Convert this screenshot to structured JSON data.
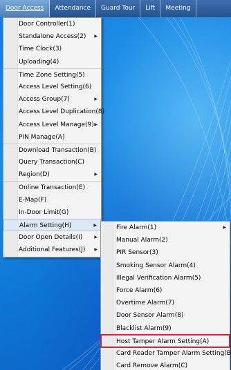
{
  "menubar": {
    "items": [
      {
        "label": "Door Access",
        "active": true
      },
      {
        "label": "Attendance"
      },
      {
        "label": "Guard Tour"
      },
      {
        "label": "Lift"
      },
      {
        "label": "Meeting"
      }
    ]
  },
  "door_access_menu": {
    "items": [
      {
        "label": "Door Controller(1)"
      },
      {
        "label": "Standalone Access(2)",
        "submenu": true
      },
      {
        "label": "Time Clock(3)"
      },
      {
        "label": "Uploading(4)"
      },
      {
        "label": "Time Zone Setting(5)"
      },
      {
        "label": "Access Level Setting(6)"
      },
      {
        "label": "Access Group(7)",
        "submenu": true
      },
      {
        "label": "Access Level Duplication(8)"
      },
      {
        "label": "Access Level Manage(9)",
        "submenu": true
      },
      {
        "label": "PIN Manage(A)"
      },
      {
        "label": "Download Transaction(B)"
      },
      {
        "label": "Query Transaction(C)"
      },
      {
        "label": "Region(D)",
        "submenu": true
      },
      {
        "label": "Online Transaction(E)"
      },
      {
        "label": "E-Map(F)"
      },
      {
        "label": "In-Door Limit(G)"
      },
      {
        "label": "Alarm Setting(H)",
        "submenu": true,
        "highlighted": true
      },
      {
        "label": "Door Open Details(I)",
        "submenu": true
      },
      {
        "label": "Additional Features(J)",
        "submenu": true
      }
    ]
  },
  "alarm_setting_menu": {
    "items": [
      {
        "label": "Fire Alarm(1)",
        "submenu": true
      },
      {
        "label": "Manual Alarm(2)"
      },
      {
        "label": "PIR Sensor(3)"
      },
      {
        "label": "Smoking Sensor Alarm(4)"
      },
      {
        "label": "Illegal Verification Alarm(5)"
      },
      {
        "label": "Force Alarm(6)"
      },
      {
        "label": "Overtime Alarm(7)"
      },
      {
        "label": "Door Sensor Alarm(8)"
      },
      {
        "label": "Blacklist Alarm(9)"
      },
      {
        "label": "Host Tamper Alarm Setting(A)",
        "annotated": true
      },
      {
        "label": "Card Reader Tamper Alarm Setting(B)"
      },
      {
        "label": "Card Remove Alarm(C)"
      }
    ]
  },
  "colors": {
    "menubar": "#24528f",
    "menu_bg": "#f4f4f4",
    "highlight": "#dce8f4",
    "annotation_box": "#e0202a",
    "desktop": "#0e76d6"
  }
}
